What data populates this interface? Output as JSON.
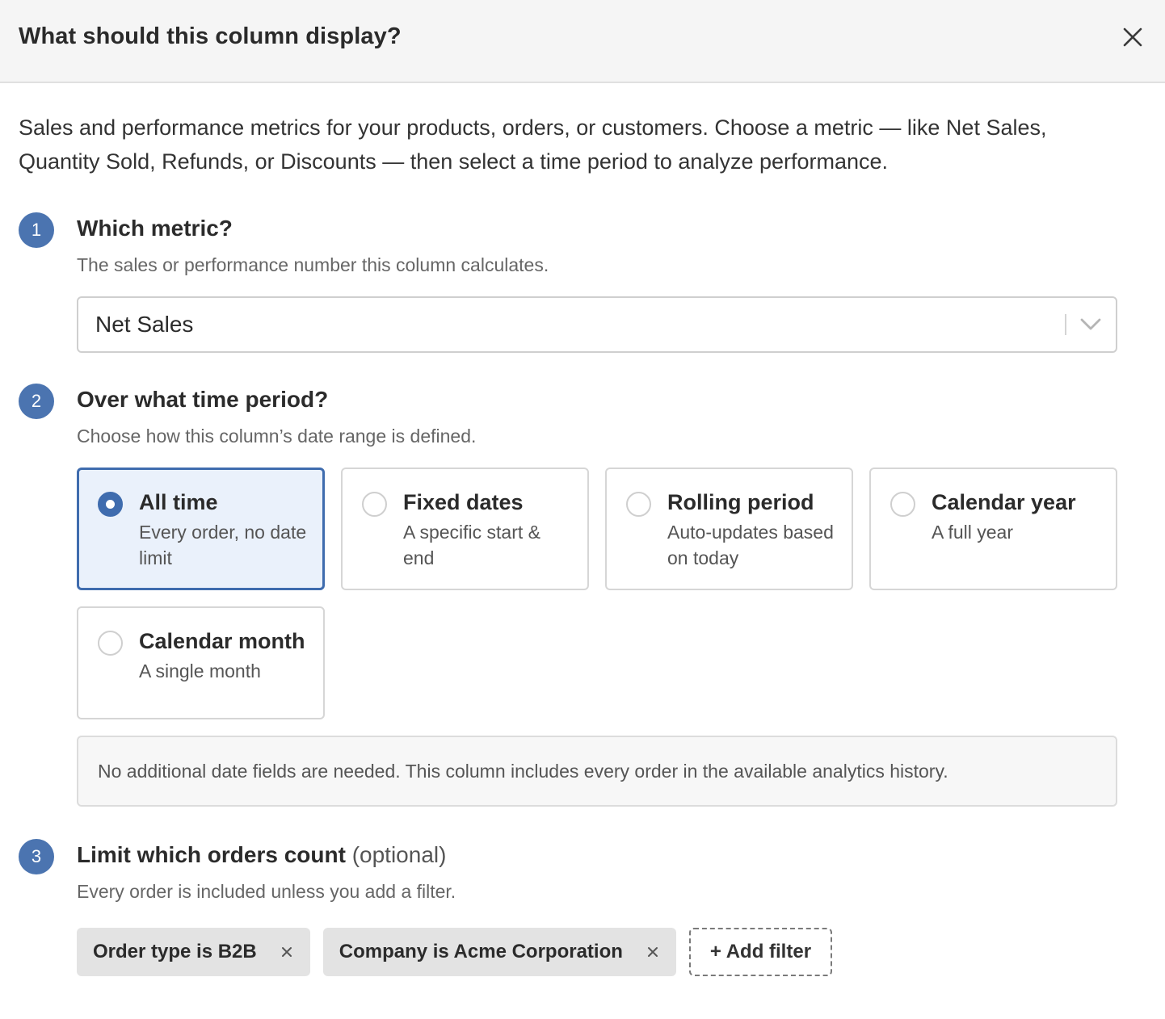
{
  "dialog": {
    "title": "What should this column display?",
    "close_label": "close"
  },
  "intro": "Sales and performance metrics for your products, orders, or customers. Choose a metric — like Net Sales, Quantity Sold, Refunds, or Discounts — then select a time period to analyze performance.",
  "step1": {
    "number": "1",
    "title": "Which metric?",
    "description": "The sales or performance number this column calculates.",
    "select_value": "Net Sales"
  },
  "step2": {
    "number": "2",
    "title": "Over what time period?",
    "description": "Choose how this column’s date range is defined.",
    "options": [
      {
        "title": "All time",
        "description": "Every order, no date limit",
        "selected": true
      },
      {
        "title": "Fixed dates",
        "description": "A specific start & end",
        "selected": false
      },
      {
        "title": "Rolling period",
        "description": "Auto-updates based on today",
        "selected": false
      },
      {
        "title": "Calendar year",
        "description": "A full year",
        "selected": false
      },
      {
        "title": "Calendar month",
        "description": "A single month",
        "selected": false
      }
    ],
    "info": "No additional date fields are needed. This column includes every order in the available analytics history."
  },
  "step3": {
    "number": "3",
    "title": "Limit which orders count",
    "optional_label": "(optional)",
    "description": "Every order is included unless you add a filter.",
    "filters": [
      {
        "label": "Order type is B2B"
      },
      {
        "label": "Company is Acme Corporation"
      }
    ],
    "add_filter_label": "+ Add filter"
  },
  "colors": {
    "accent": "#3f6cae",
    "step_badge": "#4b74b0",
    "selected_bg": "#eaf1fb",
    "header_bg": "#f5f5f5"
  }
}
